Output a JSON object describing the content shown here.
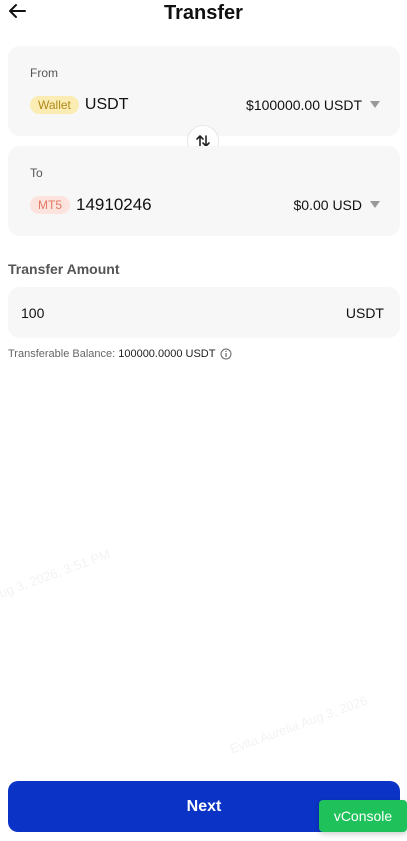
{
  "header": {
    "title": "Transfer",
    "back_icon": "arrow-left-icon"
  },
  "from": {
    "label": "From",
    "badge": "Wallet",
    "account": "USDT",
    "balance": "$100000.00 USDT"
  },
  "to": {
    "label": "To",
    "badge": "MT5",
    "account": "14910246",
    "balance": "$0.00 USD"
  },
  "swap": {
    "icon": "swap-vertical-icon"
  },
  "amount": {
    "label": "Transfer Amount",
    "value": "100",
    "unit": "USDT"
  },
  "transferable": {
    "label": "Transferable Balance:",
    "value": "100000.0000 USDT",
    "icon": "info-icon"
  },
  "watermarks": [
    "Evita Aurelia Aug 3, 2026",
    "ug 3, 2026, 3:51 PM",
    "Evita Aurelia Aug 3, 2026"
  ],
  "actions": {
    "next_label": "Next",
    "vconsole_label": "vConsole"
  },
  "colors": {
    "primary": "#0b34c6",
    "wallet_badge_bg": "#fbecb3",
    "mt5_badge_bg": "#fde3dd",
    "vconsole": "#1fc15b"
  }
}
